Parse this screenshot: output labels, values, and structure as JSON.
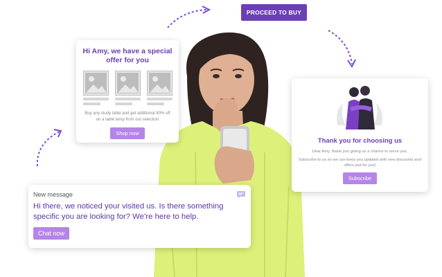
{
  "proceed_button": {
    "label": "PROCEED TO BUY"
  },
  "offer_card": {
    "title": "Hi Amy, we have a special offer for you",
    "description": "Buy any study table and get additional 80% off on a table lamp from our selection",
    "button_label": "Shop now"
  },
  "thanks_card": {
    "title": "Thank you for choosing us",
    "line1": "Dear Amy, thank you giving us a chance to serve you.",
    "line2": "Subscribe to us so we can keep you updated with new discounts and offers just for you!",
    "button_label": "Subscribe"
  },
  "message_card": {
    "header": "New message",
    "body": "Hi there, we noticed your visited us. Is there something specific you are looking for? We’re here to help.",
    "button_label": "Chat now"
  },
  "colors": {
    "brand": "#6b3fb6",
    "button": "#b585e6",
    "arrow": "#7c4bd3",
    "sweater": "#ddf07a"
  }
}
